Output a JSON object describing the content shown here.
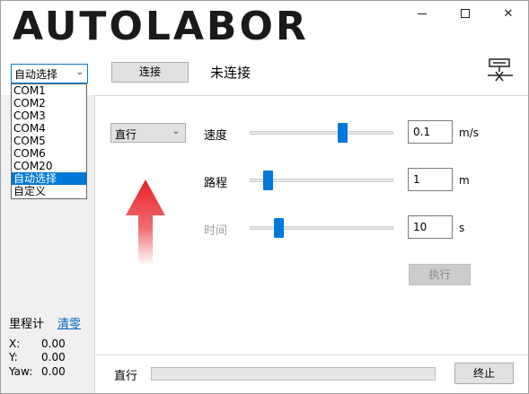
{
  "app": {
    "logo_text": "AUTOLABOR"
  },
  "window_controls": {
    "minimize": "minimize-icon",
    "maximize": "maximize-icon",
    "close": "close-icon"
  },
  "toolbar": {
    "port_selected": "自动选择",
    "connect_label": "连接",
    "connection_status": "未连接",
    "disconnect_icon": "serial-disconnect-icon"
  },
  "port_options": [
    "COM1",
    "COM2",
    "COM3",
    "COM4",
    "COM5",
    "COM6",
    "COM20",
    "自动选择",
    "自定义"
  ],
  "port_selected_index": 7,
  "control": {
    "mode": "直行",
    "speed": {
      "label": "速度",
      "value": "0.1",
      "unit": "m/s",
      "slider_fraction": 0.66,
      "enabled": true
    },
    "distance": {
      "label": "路程",
      "value": "1",
      "unit": "m",
      "slider_fraction": 0.1,
      "enabled": true
    },
    "time": {
      "label": "时间",
      "value": "10",
      "unit": "s",
      "slider_fraction": 0.18,
      "enabled": false
    },
    "execute_label": "执行"
  },
  "odometer": {
    "title": "里程计",
    "clear_label": "清零",
    "x_label": "X:",
    "x_value": "0.00",
    "y_label": "Y:",
    "y_value": "0.00",
    "yaw_label": "Yaw:",
    "yaw_value": "0.00"
  },
  "status": {
    "text": "直行",
    "progress": 0,
    "stop_label": "终止"
  },
  "colors": {
    "accent": "#0078d7",
    "arrow": "#e8202a"
  }
}
